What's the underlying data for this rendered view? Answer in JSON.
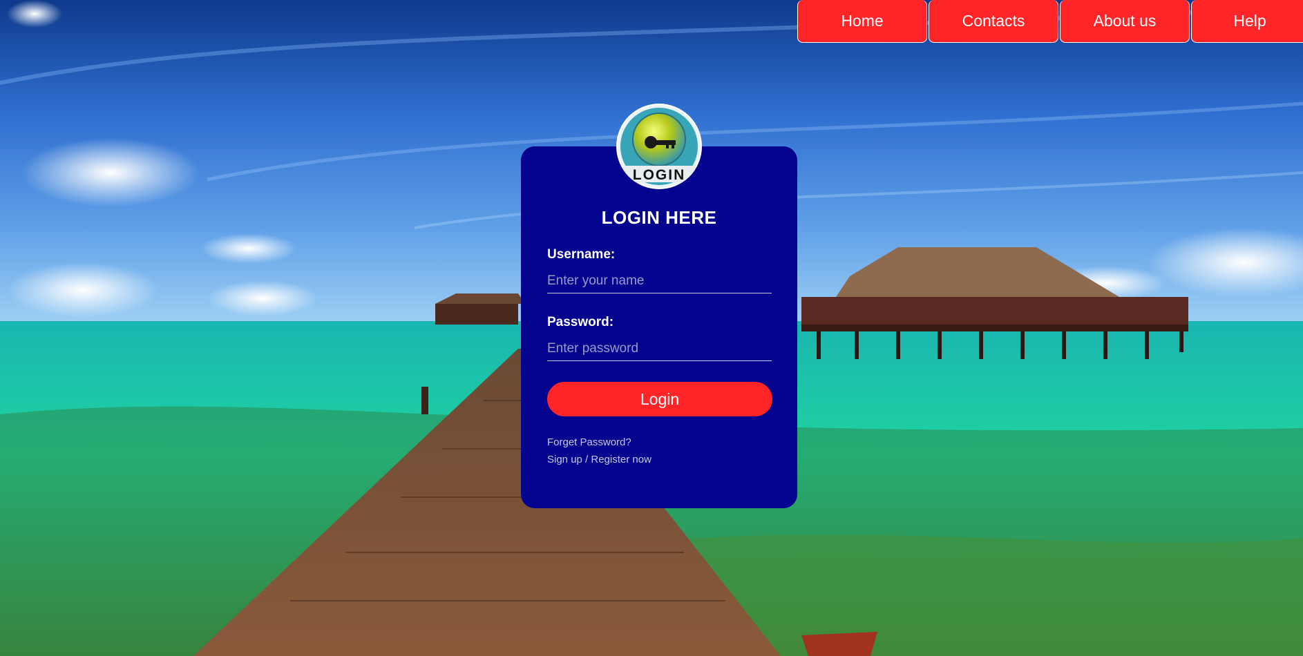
{
  "nav": {
    "items": [
      {
        "label": "Home"
      },
      {
        "label": "Contacts"
      },
      {
        "label": "About us"
      },
      {
        "label": "Help"
      }
    ]
  },
  "login": {
    "logo_text": "LOGIN",
    "title": "LOGIN HERE",
    "username_label": "Username:",
    "username_placeholder": "Enter your name",
    "username_value": "",
    "password_label": "Password:",
    "password_placeholder": "Enter password",
    "password_value": "",
    "submit_label": "Login",
    "forgot_link": "Forget Password?",
    "register_link": "Sign up / Register now"
  },
  "colors": {
    "card_bg": "#04048f",
    "accent_red": "#fe2427",
    "text_white": "#ffffff"
  },
  "icons": {
    "logo": "key-icon"
  }
}
